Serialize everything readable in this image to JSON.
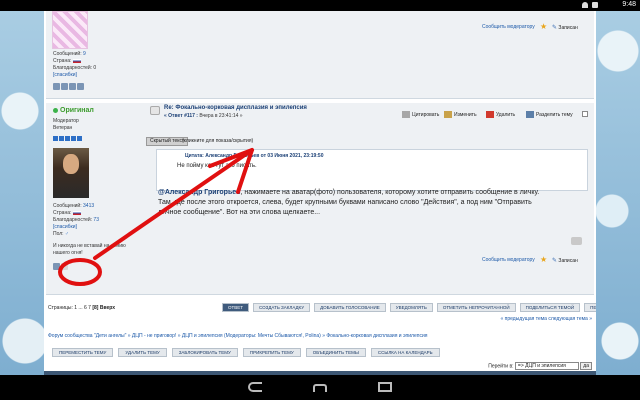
{
  "status_bar": {
    "time": "9:48"
  },
  "post1": {
    "messages_label": "Сообщений:",
    "messages": "9",
    "country_label": "Страна:",
    "thanks_label": "Благодарностей:",
    "thanks": "0",
    "thanks_link": "[спасибки]",
    "report_link": "Сообщить модератору",
    "bookmark_link": "Записан"
  },
  "post2": {
    "status": "Оригинал",
    "role": "Модератор",
    "rank": "Ветеран",
    "messages_label": "Сообщений:",
    "messages": "3413",
    "country_label": "Страна:",
    "thanks_label": "Благодарностей:",
    "thanks": "73",
    "thanks_link": "[спасибки]",
    "gender_label": "Пол:",
    "signature_1": "И никогда не вставай на линию",
    "signature_2": "нашего огня!",
    "title": "Re: Фокально-корковая дисплазия и эпилепсия",
    "reply_label": "« Ответ #117 :",
    "reply_time": "Вчера в 23:41:14 »",
    "actions": {
      "quote": "Цитировать",
      "edit": "Изменить",
      "delete": "Удалить",
      "split": "Разделить тему"
    },
    "hidden_button": "Скрытый текст",
    "hidden_note": "(кликните для показа/скрытия)",
    "quote_head": "Цитата: Александр Григорьев от 03 Июня 2021, 23:19:50",
    "quote_text": "Не пойму как тут это писать.",
    "reply_name": "@Александр Григорьев",
    "reply_text_1": ", нажимаете на аватар(фото) пользователя, которому хотите отправить сообщение в личку.",
    "reply_text_2": "Там, где после этого откроется, слева, будет крупными буквами написано слово \"Действия\", а под ним \"Отправить",
    "reply_text_3": "личное сообщение\". Вот на эти слова щелкаете...",
    "report_link": "Сообщить модератору",
    "bookmark_link": "Записан"
  },
  "pager": {
    "label": "Страницы: 1 ... 6 7",
    "current": "[8]",
    "up": "Вверх"
  },
  "topic_buttons": [
    "ОТВЕТ",
    "СОЗДАТЬ ЗАКЛАДКУ",
    "ДОБАВИТЬ ГОЛОСОВАНИЕ",
    "УВЕДОМЛЯТЬ",
    "ОТМЕТИТЬ НЕПРОЧИТАННОЙ",
    "ПОДЕЛИТЬСЯ ТЕМОЙ",
    "ПЕЧАТЬ"
  ],
  "prev_next": "« предыдущая тема следующая тема »",
  "breadcrumb": "Форум сообщества \"Дети ангелы\" » ДЦП - не приговор! » ДЦП и эпилепсия (Модераторы: Мечты Сбываются!, Polina) » Фокально-корковая дисплазия и эпилепсия",
  "mod_buttons": [
    "ПЕРЕМЕСТИТЬ ТЕМУ",
    "УДАЛИТЬ ТЕМУ",
    "ЗАБЛОКИРОВАТЬ ТЕМУ",
    "ПРИКРЕПИТЬ ТЕМУ",
    "ОБЪЕДИНИТЬ ТЕМЫ",
    "ССЫЛКА НА КАЛЕНДАРЬ"
  ],
  "goto": {
    "label": "Перейти в:",
    "selected": "=> ДЦП и эпилепсия",
    "button": "да"
  },
  "colors": {
    "online": "#3bb24a",
    "annotation": "#e01010",
    "title": "#1a3f75"
  }
}
